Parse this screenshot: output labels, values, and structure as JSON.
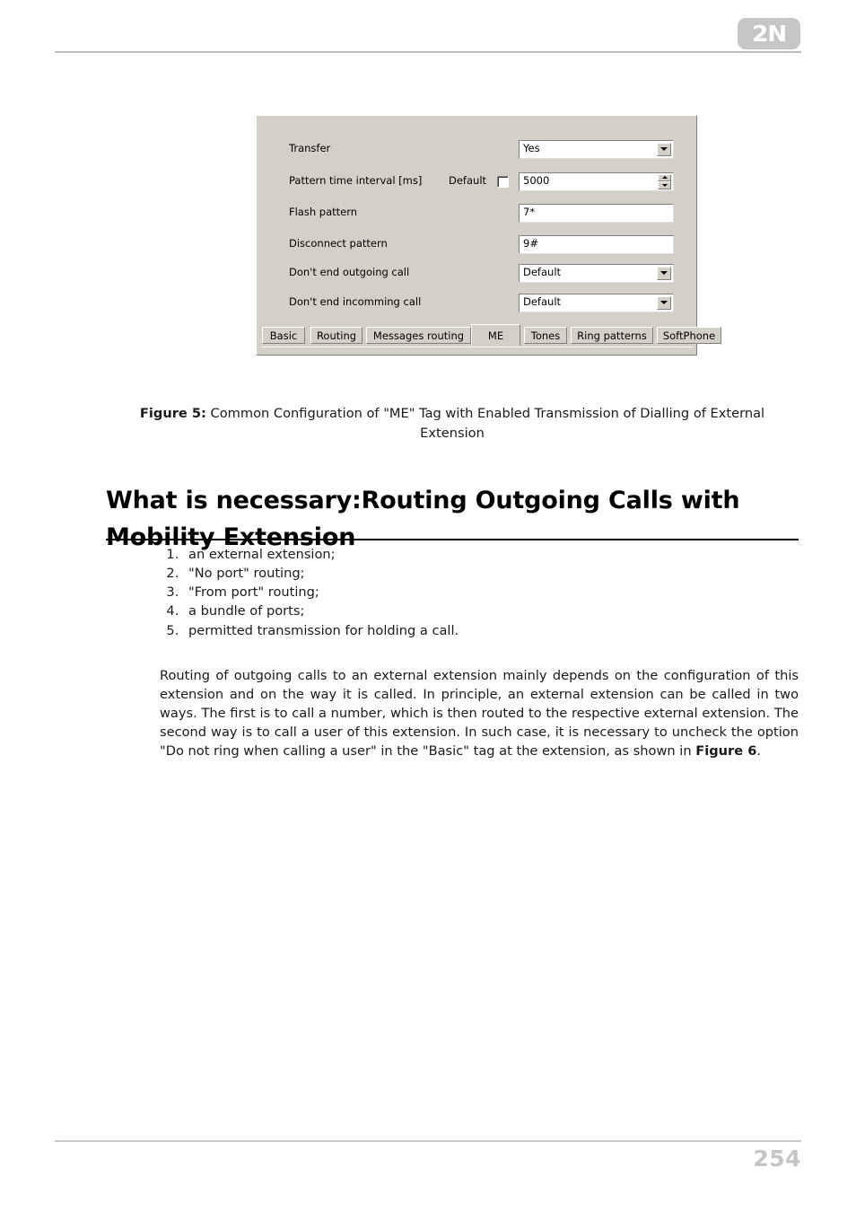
{
  "page": {
    "number": "254",
    "brand_logo_text": "2N",
    "brand_color": "#c6c6c6"
  },
  "figure": {
    "caption_prefix": "Figure 5:",
    "caption_text": " Common Configuration of \"ME\" Tag with Enabled Transmission of Dialling of External Extension",
    "dialog": {
      "background_color": "#d4d0c8",
      "rows": [
        {
          "label": "Transfer",
          "control": "combo",
          "value": "Yes"
        },
        {
          "label": "Pattern time interval [ms]",
          "control": "spin",
          "value": "5000",
          "extra_label": "Default",
          "checkbox_checked": false
        },
        {
          "label": "Flash pattern",
          "control": "text",
          "value": "7*"
        },
        {
          "label": "Disconnect pattern",
          "control": "text",
          "value": "9#"
        },
        {
          "label": "Don't end outgoing call",
          "control": "combo",
          "value": "Default"
        },
        {
          "label": "Don't end incomming call",
          "control": "combo",
          "value": "Default"
        }
      ],
      "tabs": [
        {
          "label": "Basic",
          "active": false
        },
        {
          "label": "Routing",
          "active": false
        },
        {
          "label": "Messages routing",
          "active": false
        },
        {
          "label": "ME",
          "active": true
        },
        {
          "label": "Tones",
          "active": false
        },
        {
          "label": "Ring patterns",
          "active": false
        },
        {
          "label": "SoftPhone",
          "active": false
        }
      ]
    }
  },
  "section": {
    "heading": "What is necessary:Routing Outgoing Calls with Mobility Extension",
    "requirements": [
      "an external extension;",
      "\"No port\" routing;",
      "\"From port\" routing;",
      "a bundle of ports;",
      "permitted transmission for holding a call."
    ],
    "paragraph_part1": "Routing of outgoing calls to an external extension mainly depends on the configuration of this extension and on the way it is called. In principle, an external extension can be called in two ways. The first is to call a number, which is then routed to the respective external extension. The second way is to call a user of this extension. In such case, it is necessary to uncheck the option \"Do not ring when calling a user\" in the \"Basic\" tag at the extension, as shown in ",
    "paragraph_bold_ref": "Figure 6",
    "paragraph_part2": "."
  }
}
